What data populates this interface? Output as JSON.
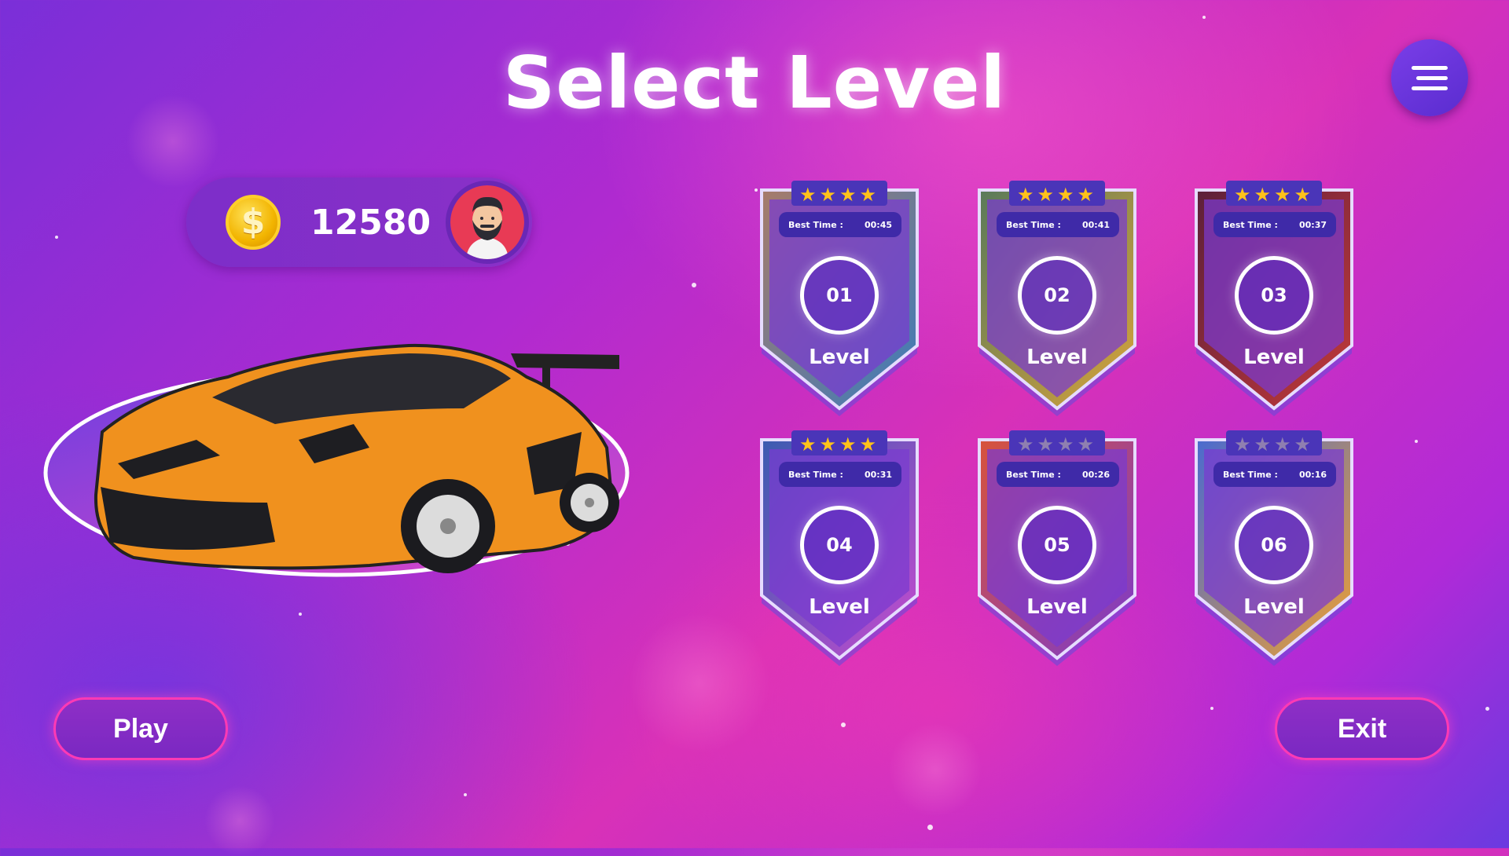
{
  "title": "Select Level",
  "menu_icon": "hamburger-menu-icon",
  "player": {
    "coins": "12580",
    "coin_symbol": "$",
    "coin_icon": "coin-icon",
    "avatar_icon": "bearded-man-avatar-icon"
  },
  "car_icon": "orange-sports-car",
  "levels": [
    {
      "number": "01",
      "label": "Level",
      "best_time_label": "Best Time :",
      "best_time": "00:45",
      "stars_earned": 4
    },
    {
      "number": "02",
      "label": "Level",
      "best_time_label": "Best Time :",
      "best_time": "00:41",
      "stars_earned": 4
    },
    {
      "number": "03",
      "label": "Level",
      "best_time_label": "Best Time :",
      "best_time": "00:37",
      "stars_earned": 4
    },
    {
      "number": "04",
      "label": "Level",
      "best_time_label": "Best Time :",
      "best_time": "00:31",
      "stars_earned": 4
    },
    {
      "number": "05",
      "label": "Level",
      "best_time_label": "Best Time :",
      "best_time": "00:26",
      "stars_earned": 0
    },
    {
      "number": "06",
      "label": "Level",
      "best_time_label": "Best Time :",
      "best_time": "00:16",
      "stars_earned": 0
    }
  ],
  "buttons": {
    "play": "Play",
    "exit": "Exit"
  },
  "colors": {
    "star_gold": "#ffc21a",
    "star_gray": "#8f7fb0",
    "accent_pink": "#ff3ab4"
  }
}
